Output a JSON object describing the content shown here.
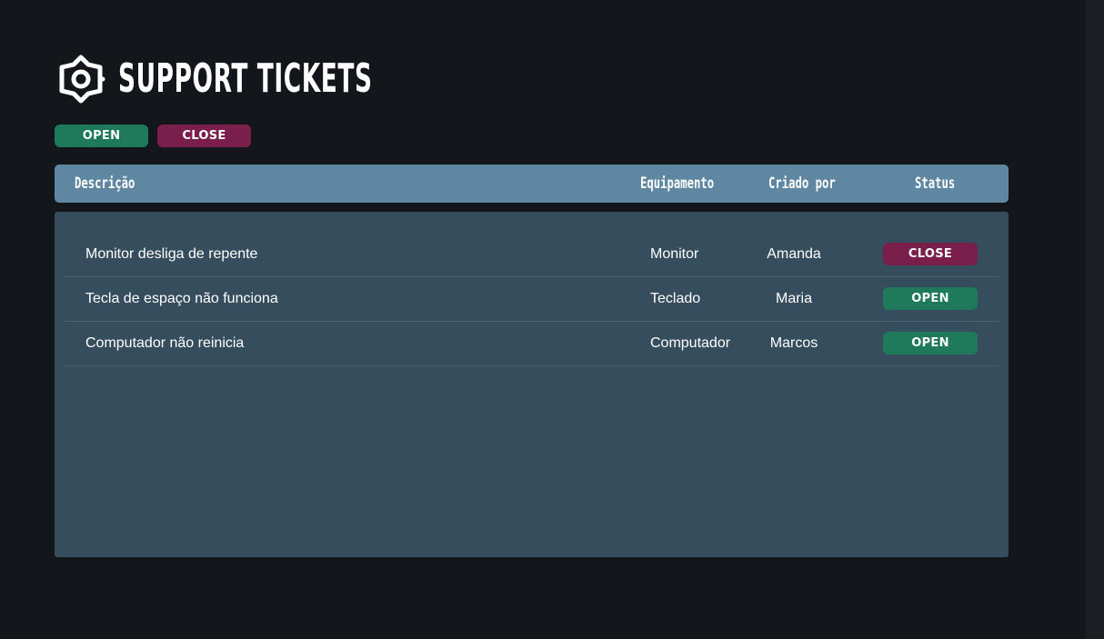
{
  "header": {
    "title": "SUPPORT TICKETS",
    "icon": "gear-icon"
  },
  "filters": {
    "open_label": "OPEN",
    "close_label": "CLOSE"
  },
  "colors": {
    "open": "#1e7a5b",
    "close": "#7a1f4b",
    "table_header": "#5f87a1",
    "table_body": "#364d5e",
    "background": "#13161b"
  },
  "table": {
    "columns": {
      "description": "Descrição",
      "equipment": "Equipamento",
      "created_by": "Criado por",
      "status": "Status"
    },
    "rows": [
      {
        "description": "Monitor desliga de repente",
        "equipment": "Monitor",
        "created_by": "Amanda",
        "status": "CLOSE"
      },
      {
        "description": "Tecla de espaço não funciona",
        "equipment": "Teclado",
        "created_by": "Maria",
        "status": "OPEN"
      },
      {
        "description": "Computador não reinicia",
        "equipment": "Computador",
        "created_by": "Marcos",
        "status": "OPEN"
      }
    ]
  }
}
